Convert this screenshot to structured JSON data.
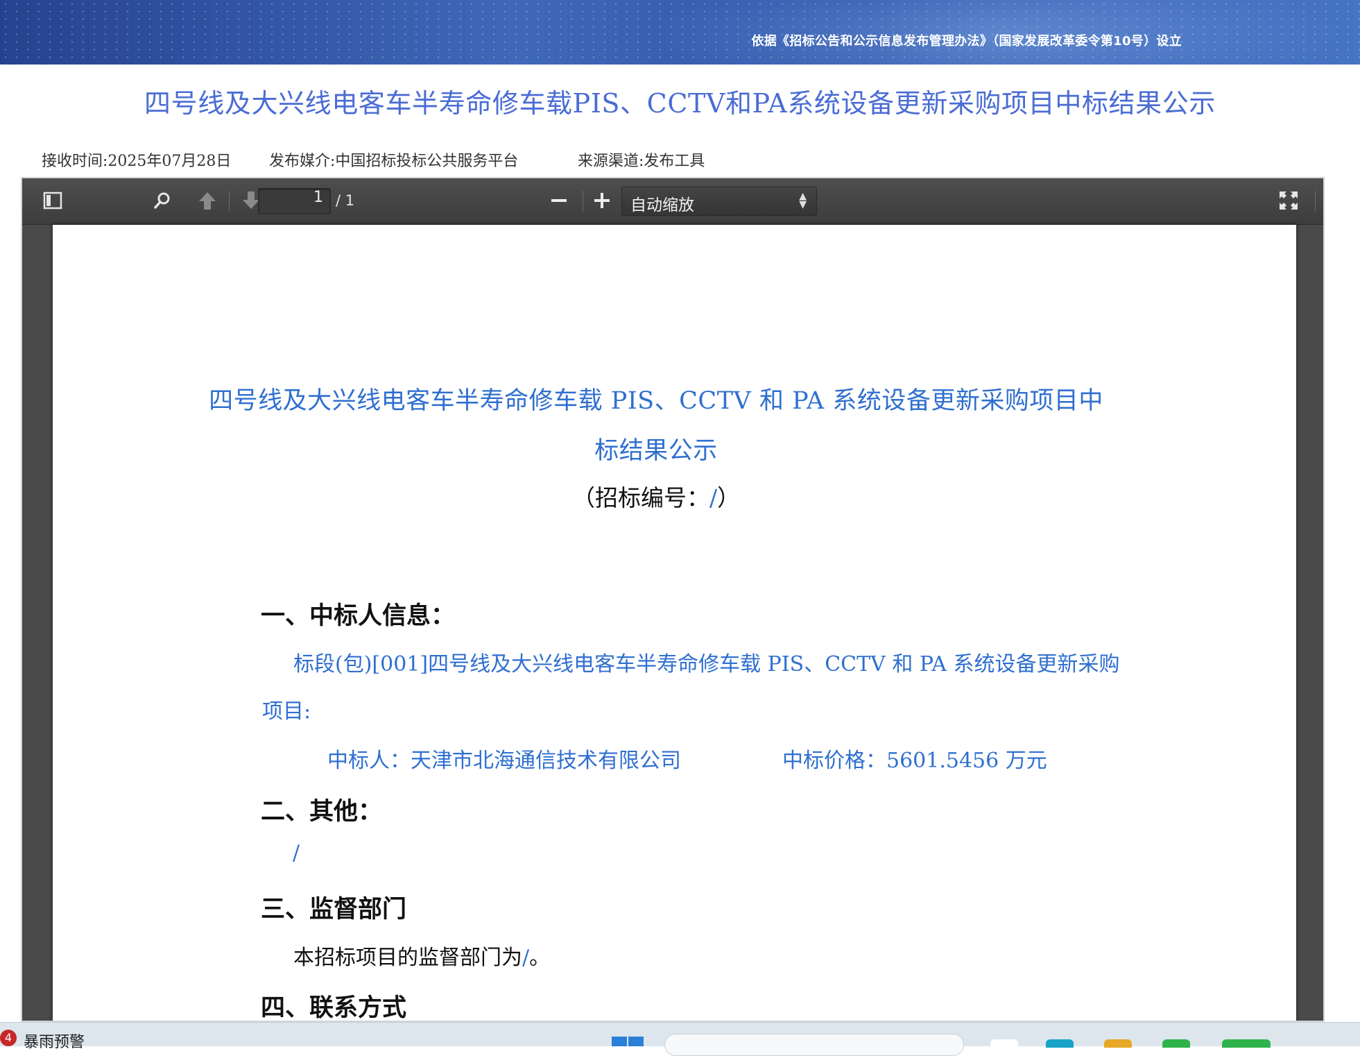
{
  "banner": {
    "basis_text": "依据《招标公告和公示信息发布管理办法》（国家发展改革委令第10号）设立"
  },
  "page_title": "四号线及大兴线电客车半寿命修车载PIS、CCTV和PA系统设备更新采购项目中标结果公示",
  "meta": {
    "received_time": "接收时间:2025年07月28日",
    "media": "发布媒介:中国招标投标公共服务平台",
    "channel": "来源渠道:发布工具"
  },
  "viewer": {
    "page_number": "1",
    "page_total": "/ 1",
    "zoom_mode": "自动缩放",
    "icons": [
      "sidebar-toggle-icon",
      "search-icon",
      "previous-page-icon",
      "next-page-icon",
      "zoom-out-icon",
      "zoom-in-icon",
      "fullscreen-icon"
    ]
  },
  "document": {
    "title_line1": "四号线及大兴线电客车半寿命修车载 PIS、CCTV 和 PA 系统设备更新采购项目中",
    "title_line2": "标结果公示",
    "code_prefix": "（招标编号：",
    "code_value": "/",
    "code_suffix": "）",
    "section1_heading": "一、中标人信息：",
    "section1_lot_line1": "标段(包)[001]四号线及大兴线电客车半寿命修车载 PIS、CCTV 和 PA 系统设备更新采购",
    "section1_lot_line2": "项目:",
    "winner_label": "中标人：天津市北海通信技术有限公司",
    "price_label": "中标价格：5601.5456 万元",
    "section2_heading": "二、其他：",
    "section2_value": "/",
    "section3_heading": "三、监督部门",
    "section3_text_prefix": "本招标项目的监督部门为",
    "section3_text_value": "/",
    "section3_text_suffix": "。",
    "section4_heading": "四、联系方式"
  },
  "taskbar": {
    "badge_count": "4",
    "weather_text": "暴雨预警"
  },
  "colors": {
    "title_blue": "#4a6cd4",
    "doc_blue": "#2f6fd0",
    "toolbar_dark": "#3d3d3d"
  }
}
